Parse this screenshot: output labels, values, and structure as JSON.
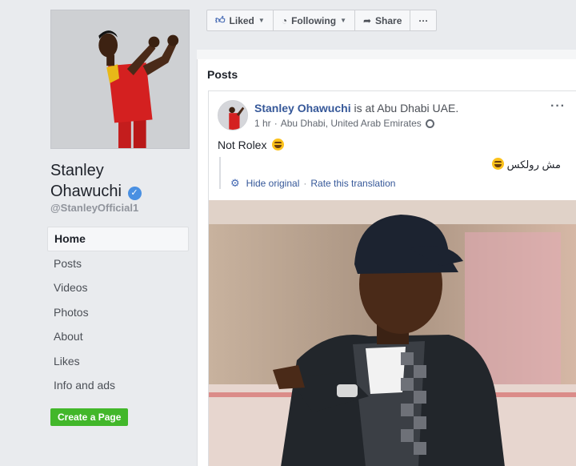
{
  "profile": {
    "name_line1": "Stanley",
    "name_line2": "Ohawuchi",
    "handle": "@StanleyOfficial1",
    "photo_icon": "person-celebrating-photo"
  },
  "nav": {
    "items": [
      {
        "label": "Home",
        "active": true
      },
      {
        "label": "Posts"
      },
      {
        "label": "Videos"
      },
      {
        "label": "Photos"
      },
      {
        "label": "About"
      },
      {
        "label": "Likes"
      },
      {
        "label": "Info and ads"
      }
    ]
  },
  "create_page_label": "Create a Page",
  "actions": {
    "liked": "Liked",
    "following": "Following",
    "share": "Share",
    "more": "···"
  },
  "posts_header": "Posts",
  "post": {
    "author": "Stanley Ohawuchi",
    "location_text": " is at Abu Dhabi UAE.",
    "time": "1 hr",
    "place": "Abu Dhabi, United Arab Emirates",
    "text": "Not Rolex",
    "translation_original": "مش رولكس",
    "hide_original": "Hide original",
    "rate_translation": "Rate this translation",
    "options": "···"
  },
  "colors": {
    "link": "#365899",
    "create_button": "#42b72a",
    "verified": "#4a90e2",
    "background": "#e9ebee"
  }
}
